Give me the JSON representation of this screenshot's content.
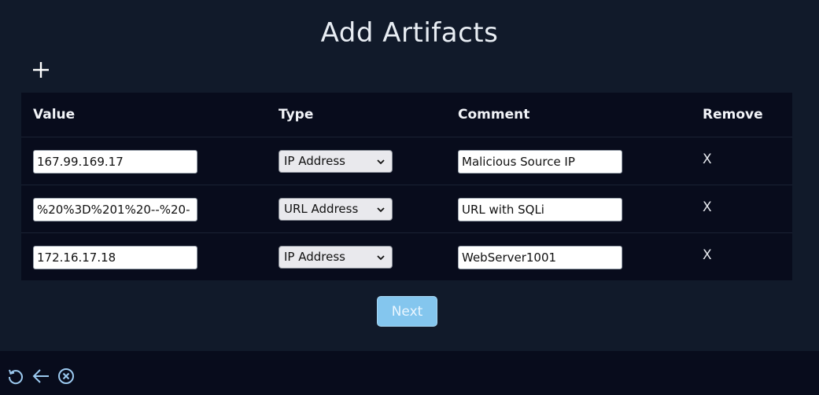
{
  "page": {
    "title": "Add Artifacts"
  },
  "toolbar": {
    "add_icon": "plus-icon"
  },
  "table": {
    "headers": {
      "value": "Value",
      "type": "Type",
      "comment": "Comment",
      "remove": "Remove"
    },
    "rows": [
      {
        "value": "167.99.169.17",
        "type": "IP Address",
        "comment": "Malicious Source IP",
        "remove": "X"
      },
      {
        "value": "%20%3D%201%20--%20-",
        "type": "URL Address",
        "comment": "URL with SQLi",
        "remove": "X"
      },
      {
        "value": "172.16.17.18",
        "type": "IP Address",
        "comment": "WebServer1001",
        "remove": "X"
      }
    ]
  },
  "actions": {
    "next_label": "Next"
  },
  "bottom_bar": {
    "icons": [
      "refresh-icon",
      "back-arrow-icon",
      "close-circle-icon"
    ]
  },
  "colors": {
    "background": "#111a2a",
    "table_bg": "#080c1c",
    "accent": "#84c6ee"
  }
}
